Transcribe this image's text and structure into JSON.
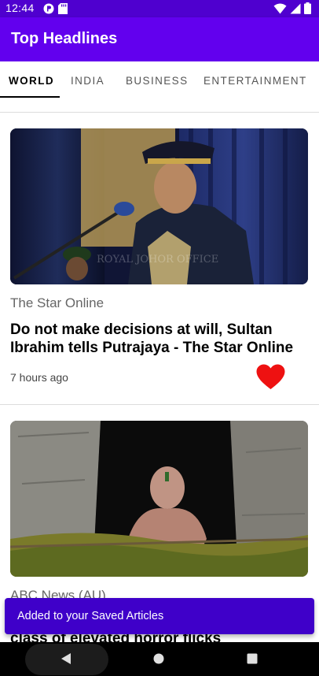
{
  "status_bar": {
    "time": "12:44"
  },
  "app_bar": {
    "title": "Top Headlines"
  },
  "tabs": [
    {
      "label": "WORLD",
      "active": true
    },
    {
      "label": "INDIA",
      "active": false
    },
    {
      "label": "BUSINESS",
      "active": false
    },
    {
      "label": "ENTERTAINMENT",
      "active": false
    }
  ],
  "articles": [
    {
      "source": "The Star Online",
      "title": "Do not make decisions at will, Sultan Ibrahim tells Putrajaya - The Star Online",
      "time_ago": "7 hours ago",
      "saved": true,
      "watermark": "ROYAL JOHOR OFFICE"
    },
    {
      "source": "ABC News (AU)",
      "title": "class of elevated horror flicks Midsommar"
    }
  ],
  "snackbar": {
    "message": "Added to your Saved Articles"
  },
  "colors": {
    "status_bar": "#4f00cf",
    "app_bar": "#6200ee",
    "snackbar": "#3f00c9",
    "heart": "#ee1111"
  }
}
